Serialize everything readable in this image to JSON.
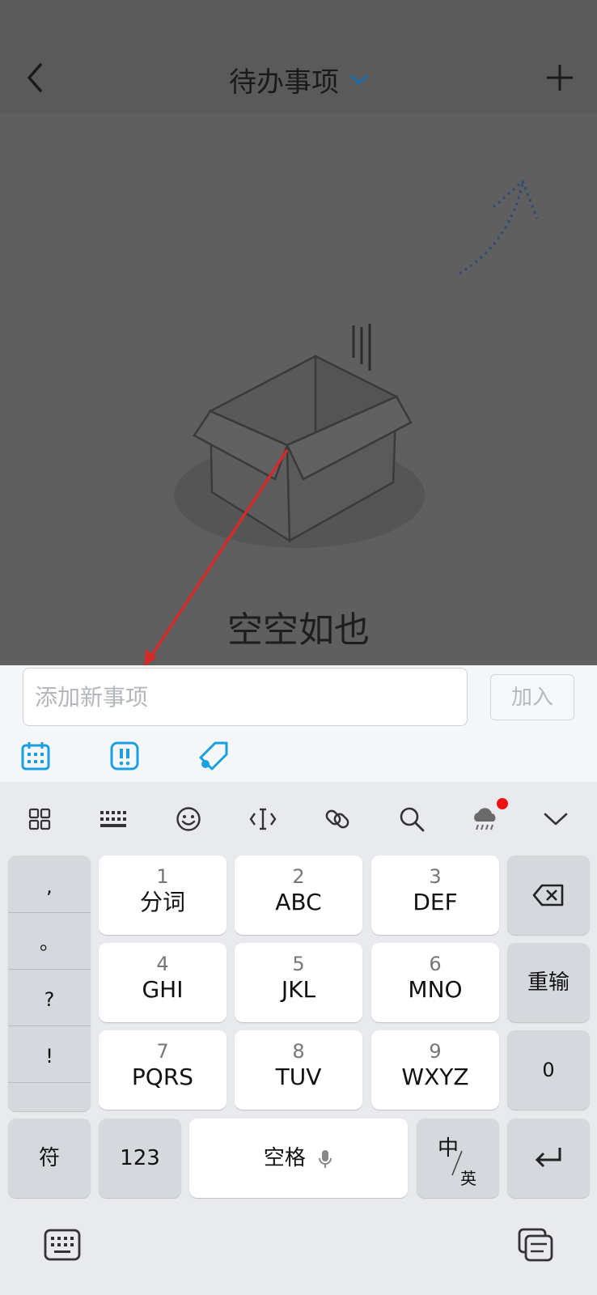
{
  "header": {
    "title": "待办事项"
  },
  "empty_state": {
    "text": "空空如也"
  },
  "input": {
    "placeholder": "添加新事项",
    "value": ""
  },
  "add_button": {
    "label": "加入"
  },
  "toolbar_icons": [
    "calendar-icon",
    "priority-icon",
    "tag-icon"
  ],
  "keyboard": {
    "top_bar_icons": [
      "grid-icon",
      "keyboard-layout-icon",
      "emoji-icon",
      "cursor-icon",
      "link-icon",
      "search-icon",
      "weather-icon",
      "collapse-icon"
    ],
    "punctuation": [
      ",",
      "。",
      "?",
      "!"
    ],
    "keys": [
      {
        "num": "1",
        "letters": "分词"
      },
      {
        "num": "2",
        "letters": "ABC"
      },
      {
        "num": "3",
        "letters": "DEF"
      },
      {
        "num": "4",
        "letters": "GHI"
      },
      {
        "num": "5",
        "letters": "JKL"
      },
      {
        "num": "6",
        "letters": "MNO"
      },
      {
        "num": "7",
        "letters": "PQRS"
      },
      {
        "num": "8",
        "letters": "TUV"
      },
      {
        "num": "9",
        "letters": "WXYZ"
      }
    ],
    "reinput": "重输",
    "zero": "0",
    "symbols": "符",
    "numbers": "123",
    "space": "空格",
    "lang_main": "中",
    "lang_sub": "英"
  },
  "colors": {
    "accent": "#1aa0e0",
    "arrow": "#d32a2a",
    "notification": "#ee1111"
  }
}
